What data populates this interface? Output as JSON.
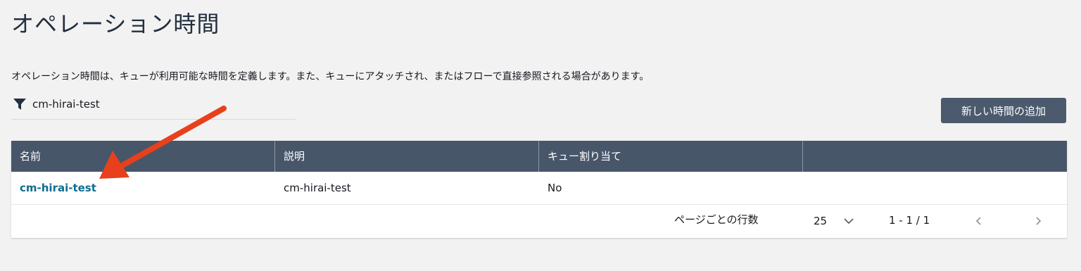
{
  "page": {
    "title": "オペレーション時間",
    "description": "オペレーション時間は、キューが利用可能な時間を定義します。また、キューにアタッチされ、またはフローで直接参照される場合があります。"
  },
  "filter": {
    "icon": "filter-icon",
    "value": "cm-hirai-test"
  },
  "toolbar": {
    "add_label": "新しい時間の追加"
  },
  "table": {
    "columns": [
      "名前",
      "説明",
      "キュー割り当て",
      ""
    ],
    "rows": [
      {
        "name": "cm-hirai-test",
        "description": "cm-hirai-test",
        "queue_assigned": "No"
      }
    ]
  },
  "pagination": {
    "rows_per_page_label": "ページごとの行数",
    "rows_per_page": "25",
    "range": "1 - 1 / 1",
    "prev_icon": "chevron-left-icon",
    "next_icon": "chevron-right-icon"
  },
  "colors": {
    "table_header": "#475669",
    "link": "#0f6c8f",
    "button": "#4b5a6d",
    "arrow": "#e8401c"
  }
}
